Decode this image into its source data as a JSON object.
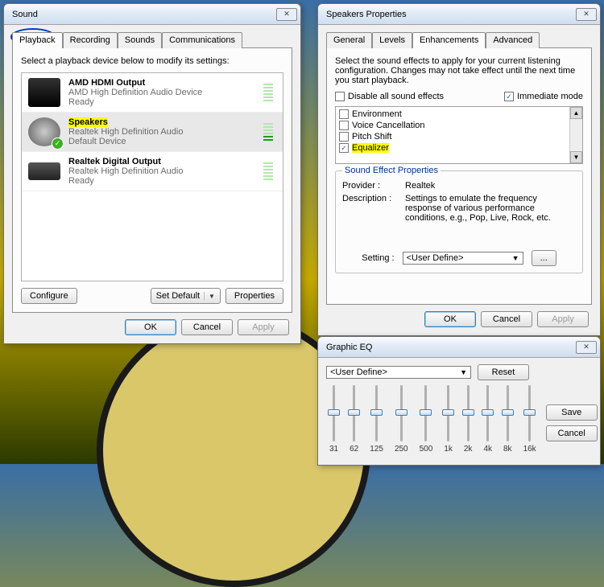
{
  "sound_dialog": {
    "title": "Sound",
    "tabs": [
      "Playback",
      "Recording",
      "Sounds",
      "Communications"
    ],
    "active_tab": 0,
    "instruction": "Select a playback device below to modify its settings:",
    "devices": [
      {
        "name": "AMD HDMI Output",
        "sub1": "AMD High Definition Audio Device",
        "sub2": "Ready",
        "icon": "screen",
        "default": false,
        "selected": false
      },
      {
        "name": "Speakers",
        "sub1": "Realtek High Definition Audio",
        "sub2": "Default Device",
        "icon": "speaker",
        "default": true,
        "selected": true,
        "highlight": true
      },
      {
        "name": "Realtek Digital Output",
        "sub1": "Realtek High Definition Audio",
        "sub2": "Ready",
        "icon": "digital",
        "default": false,
        "selected": false
      }
    ],
    "configure_btn": "Configure",
    "set_default_btn": "Set Default",
    "properties_btn": "Properties",
    "ok_btn": "OK",
    "cancel_btn": "Cancel",
    "apply_btn": "Apply"
  },
  "speakers_dialog": {
    "title": "Speakers Properties",
    "tabs": [
      "General",
      "Levels",
      "Enhancements",
      "Advanced"
    ],
    "active_tab": 2,
    "description": "Select the sound effects to apply for your current listening configuration. Changes may not take effect until the next time you start playback.",
    "disable_all": {
      "label": "Disable all sound effects",
      "checked": false
    },
    "immediate": {
      "label": "Immediate mode",
      "checked": true
    },
    "effects": [
      {
        "label": "Environment",
        "checked": false
      },
      {
        "label": "Voice Cancellation",
        "checked": false
      },
      {
        "label": "Pitch Shift",
        "checked": false
      },
      {
        "label": "Equalizer",
        "checked": true,
        "highlight": true
      }
    ],
    "group_title": "Sound Effect Properties",
    "provider_label": "Provider :",
    "provider_value": "Realtek",
    "desc_label": "Description :",
    "desc_value": "Settings to emulate the frequency response of various performance conditions,  e.g., Pop, Live, Rock, etc.",
    "setting_label": "Setting :",
    "setting_value": "<User Define>",
    "more_btn": "...",
    "ok_btn": "OK",
    "cancel_btn": "Cancel",
    "apply_btn": "Apply"
  },
  "eq_dialog": {
    "title": "Graphic EQ",
    "preset": "<User Define>",
    "reset_btn": "Reset",
    "save_btn": "Save",
    "cancel_btn": "Cancel",
    "bands": [
      "31",
      "62",
      "125",
      "250",
      "500",
      "1k",
      "2k",
      "4k",
      "8k",
      "16k"
    ]
  }
}
